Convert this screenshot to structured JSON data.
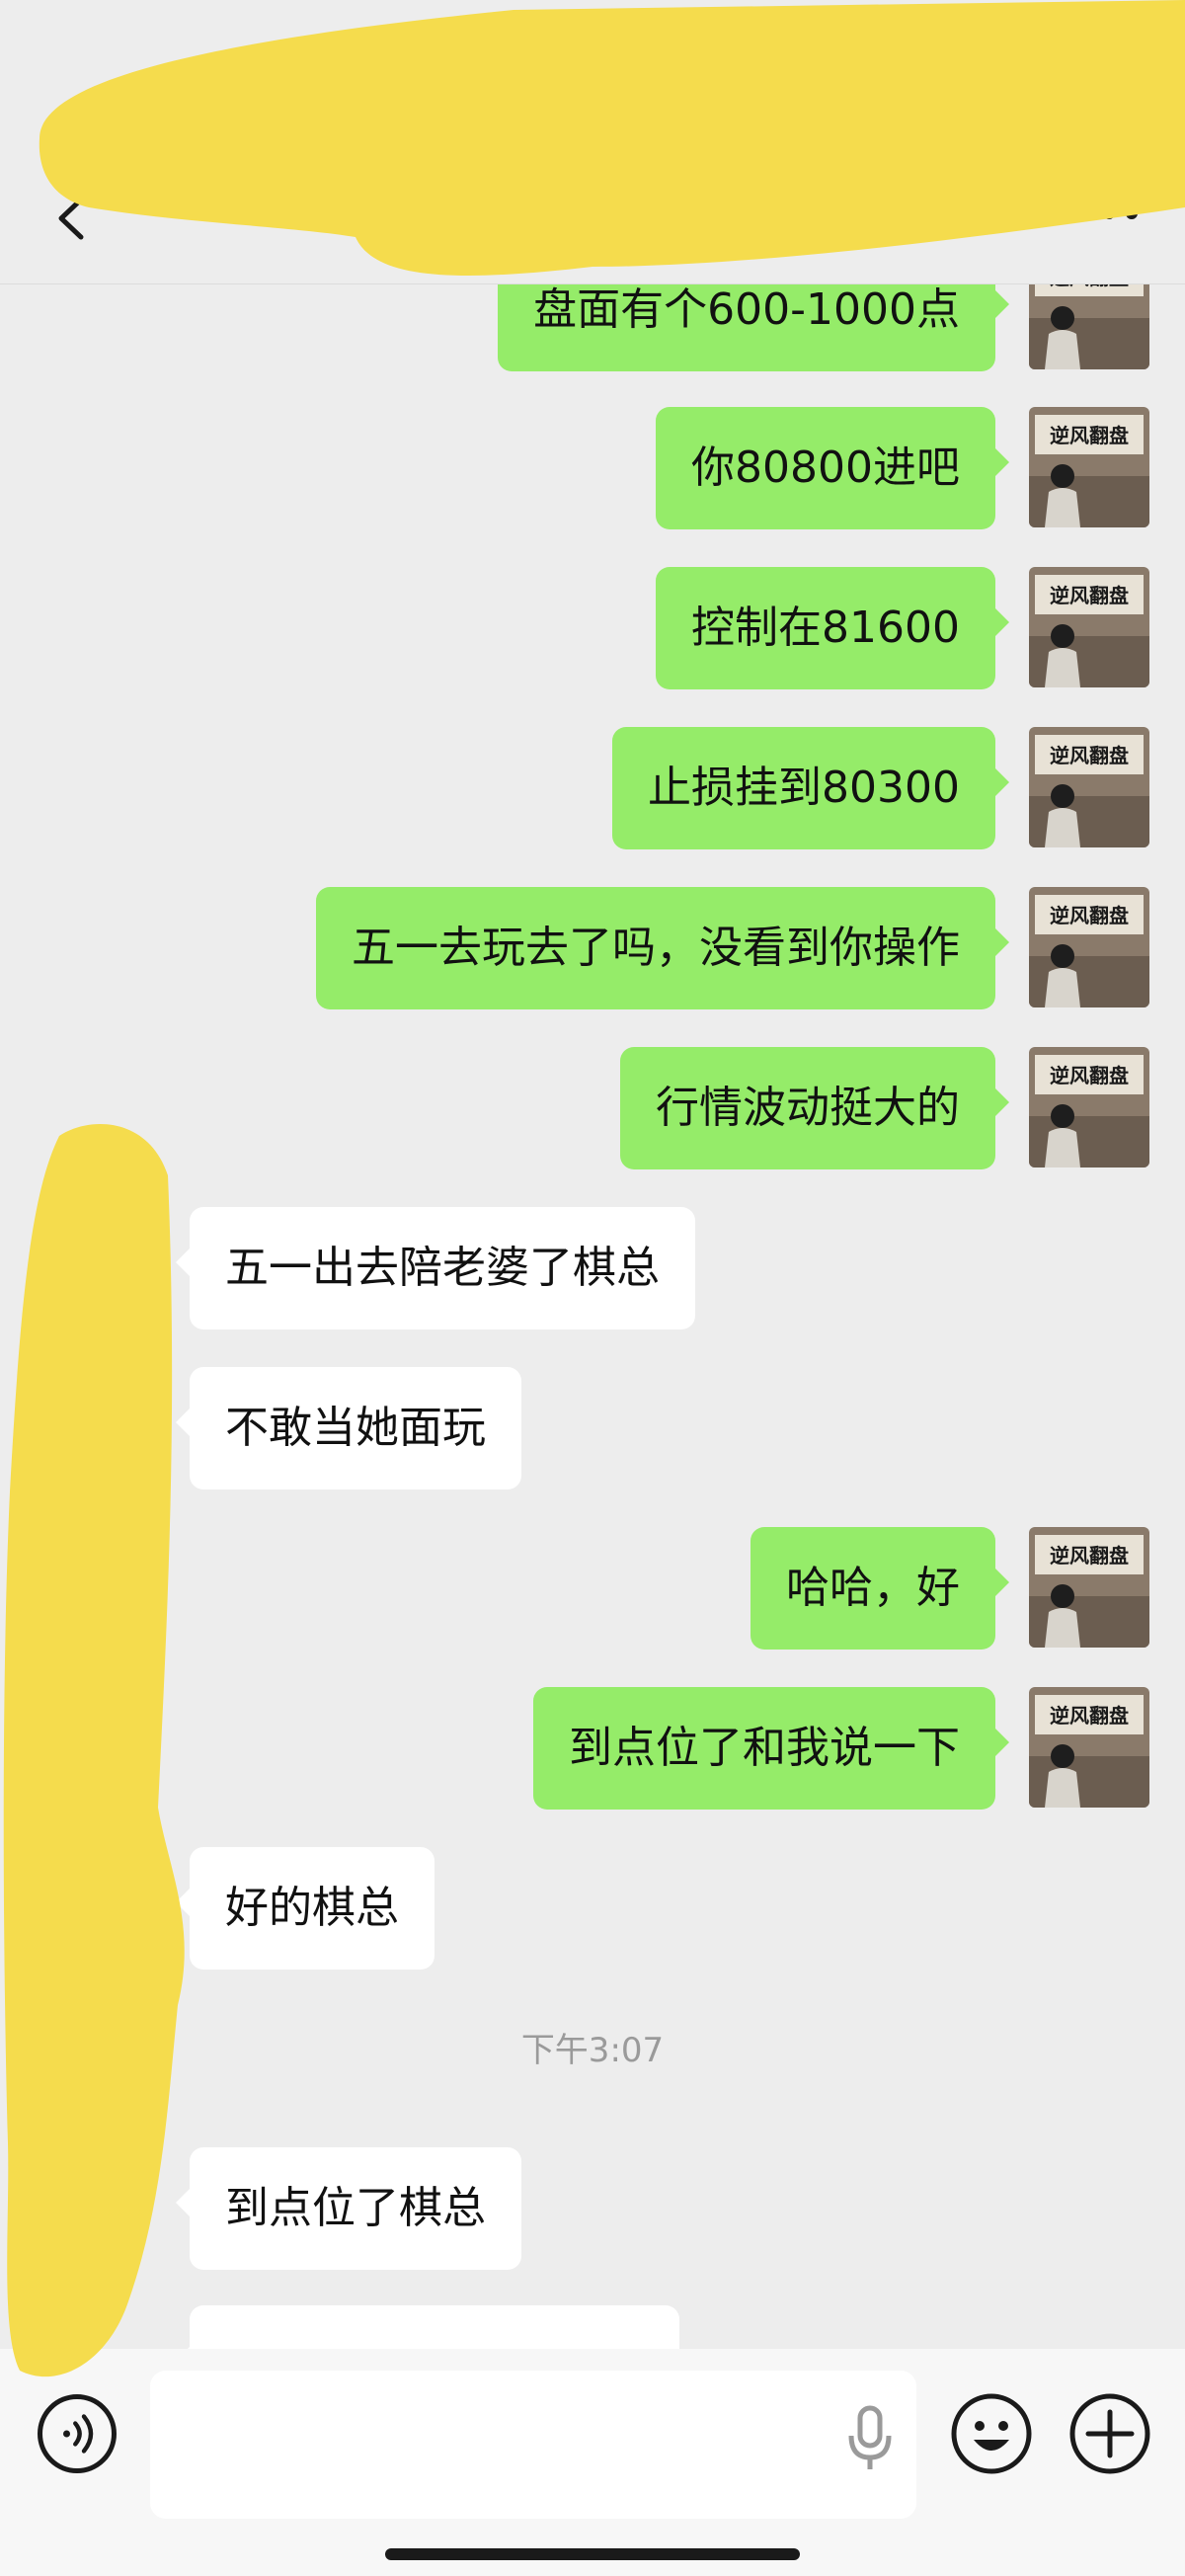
{
  "header": {
    "title": "",
    "back_icon": "chevron-left-icon",
    "more_icon": "more-dots-icon"
  },
  "messages": [
    {
      "dir": "out",
      "text": "盘面有个600-1000点"
    },
    {
      "dir": "out",
      "text": "你80800进吧"
    },
    {
      "dir": "out",
      "text": "控制在81600"
    },
    {
      "dir": "out",
      "text": "止损挂到80300"
    },
    {
      "dir": "out",
      "text": "五一去玩去了吗，没看到你操作"
    },
    {
      "dir": "out",
      "text": "行情波动挺大的"
    },
    {
      "dir": "in",
      "text": "五一出去陪老婆了棋总"
    },
    {
      "dir": "in",
      "text": "不敢当她面玩"
    },
    {
      "dir": "out",
      "text": "哈哈，好"
    },
    {
      "dir": "out",
      "text": "到点位了和我说一下"
    },
    {
      "dir": "in",
      "text": "好的棋总"
    },
    {
      "dir": "in",
      "text": "到点位了棋总"
    }
  ],
  "timestamp": "下午3:07",
  "avatar": {
    "sign_text": "逆风翻盘"
  },
  "bottom_bar": {
    "voice_icon": "voice-icon",
    "mic_icon": "mic-icon",
    "emoji_icon": "emoji-icon",
    "plus_icon": "plus-icon",
    "input_value": ""
  },
  "colors": {
    "outgoing_bubble": "#95ec69",
    "incoming_bubble": "#ffffff",
    "background": "#ededed",
    "redaction": "#f5dc4d"
  }
}
